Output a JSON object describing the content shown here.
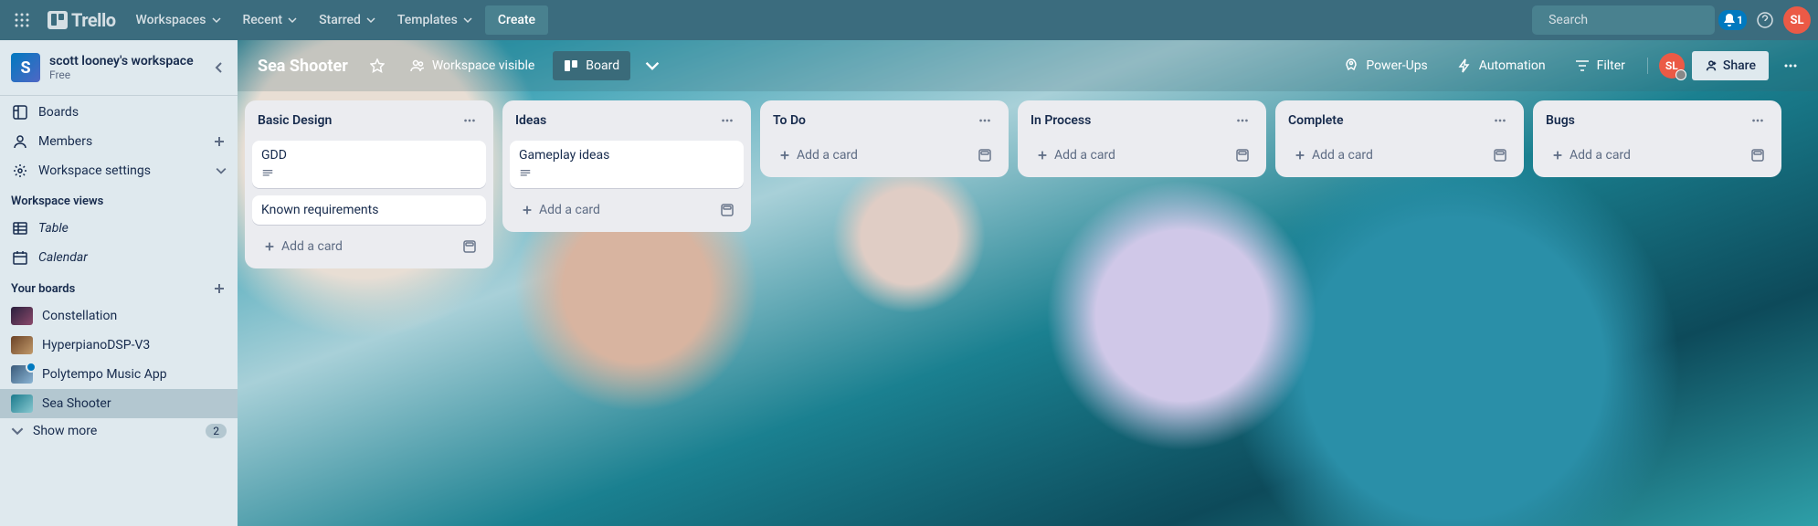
{
  "topbar": {
    "logo_text": "Trello",
    "nav": {
      "workspaces": "Workspaces",
      "recent": "Recent",
      "starred": "Starred",
      "templates": "Templates"
    },
    "create": "Create",
    "search_placeholder": "Search",
    "notification_count": "1",
    "avatar_initials": "SL"
  },
  "sidebar": {
    "workspace_initial": "S",
    "workspace_name": "scott looney's workspace",
    "workspace_plan": "Free",
    "items": {
      "boards": "Boards",
      "members": "Members",
      "settings": "Workspace settings"
    },
    "views_heading": "Workspace views",
    "views": {
      "table": "Table",
      "calendar": "Calendar"
    },
    "boards_heading": "Your boards",
    "boards": [
      {
        "name": "Constellation"
      },
      {
        "name": "HyperpianoDSP-V3"
      },
      {
        "name": "Polytempo Music App"
      },
      {
        "name": "Sea Shooter"
      }
    ],
    "show_more": "Show more",
    "show_more_count": "2"
  },
  "board_header": {
    "title": "Sea Shooter",
    "workspace_visible": "Workspace visible",
    "view": "Board",
    "power_ups": "Power-Ups",
    "automation": "Automation",
    "filter": "Filter",
    "avatar_initials": "SL",
    "share": "Share"
  },
  "lists": [
    {
      "title": "Basic Design",
      "cards": [
        {
          "title": "GDD",
          "has_description": true
        },
        {
          "title": "Known requirements",
          "has_description": false
        }
      ]
    },
    {
      "title": "Ideas",
      "cards": [
        {
          "title": "Gameplay ideas",
          "has_description": true
        }
      ]
    },
    {
      "title": "To Do",
      "cards": []
    },
    {
      "title": "In Process",
      "cards": []
    },
    {
      "title": "Complete",
      "cards": []
    },
    {
      "title": "Bugs",
      "cards": []
    }
  ],
  "add_card_label": "Add a card"
}
